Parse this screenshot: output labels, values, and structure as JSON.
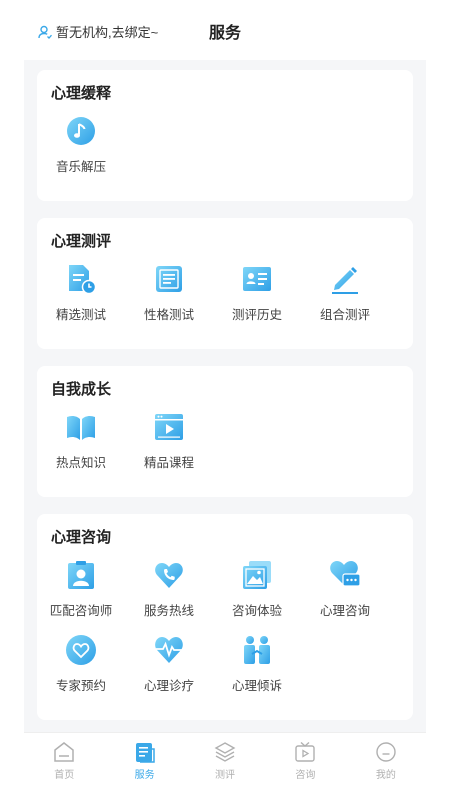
{
  "header": {
    "org_text": "暂无机构,去绑定~",
    "title": "服务"
  },
  "sections": [
    {
      "title": "心理缓释",
      "items": [
        {
          "label": "音乐解压",
          "icon": "music-icon"
        }
      ]
    },
    {
      "title": "心理测评",
      "items": [
        {
          "label": "精选测试",
          "icon": "test-doc-icon"
        },
        {
          "label": "性格测试",
          "icon": "personality-book-icon"
        },
        {
          "label": "测评历史",
          "icon": "history-card-icon"
        },
        {
          "label": "组合测评",
          "icon": "pencil-icon"
        }
      ]
    },
    {
      "title": "自我成长",
      "items": [
        {
          "label": "热点知识",
          "icon": "open-book-icon"
        },
        {
          "label": "精品课程",
          "icon": "video-course-icon"
        }
      ]
    },
    {
      "title": "心理咨询",
      "items": [
        {
          "label": "匹配咨询师",
          "icon": "counselor-icon"
        },
        {
          "label": "服务热线",
          "icon": "phone-heart-icon"
        },
        {
          "label": "咨询体验",
          "icon": "photo-stack-icon"
        },
        {
          "label": "心理咨询",
          "icon": "chat-heart-icon"
        },
        {
          "label": "专家预约",
          "icon": "heart-ring-icon"
        },
        {
          "label": "心理诊疗",
          "icon": "heartbeat-icon"
        },
        {
          "label": "心理倾诉",
          "icon": "two-people-icon"
        }
      ]
    }
  ],
  "tabbar": [
    {
      "label": "首页",
      "icon": "home-icon"
    },
    {
      "label": "服务",
      "icon": "service-doc-icon",
      "active": true
    },
    {
      "label": "测评",
      "icon": "layers-icon"
    },
    {
      "label": "咨询",
      "icon": "tv-play-icon"
    },
    {
      "label": "我的",
      "icon": "smile-icon"
    }
  ],
  "colors": {
    "accent": "#3aa8e8",
    "icon_light": "#7fd0f7",
    "icon_dark": "#2e9fe6",
    "background": "#f5f6f8",
    "tab_inactive": "#b0b0b0"
  }
}
